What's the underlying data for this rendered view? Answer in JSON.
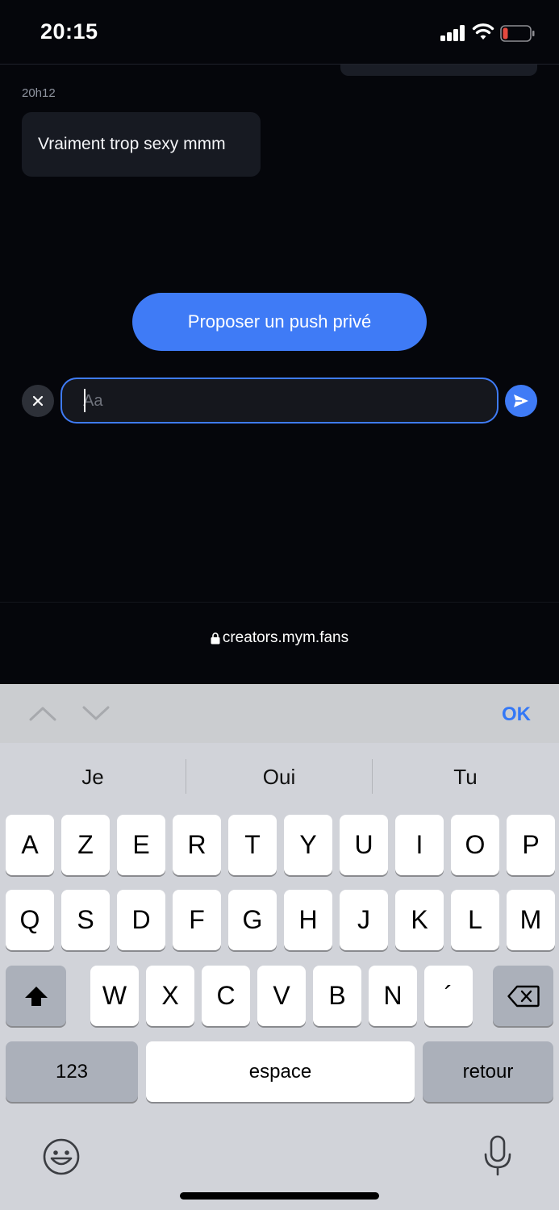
{
  "status_bar": {
    "time": "20:15",
    "icons": [
      "signal-icon",
      "wifi-icon",
      "battery-low-icon"
    ],
    "battery_color": "#e5493f"
  },
  "chat": {
    "message_time": "20h12",
    "message_text": "Vraiment trop sexy mmm",
    "push_button_label": "Proposer un push privé",
    "input_placeholder": "Aa",
    "input_value": ""
  },
  "url_bar": {
    "url": "creators.mym.fans"
  },
  "accessory": {
    "ok_label": "OK"
  },
  "keyboard": {
    "suggestions": [
      "Je",
      "Oui",
      "Tu"
    ],
    "row1": [
      "A",
      "Z",
      "E",
      "R",
      "T",
      "Y",
      "U",
      "I",
      "O",
      "P"
    ],
    "row2": [
      "Q",
      "S",
      "D",
      "F",
      "G",
      "H",
      "J",
      "K",
      "L",
      "M"
    ],
    "row3": [
      "W",
      "X",
      "C",
      "V",
      "B",
      "N",
      "´"
    ],
    "numbers_label": "123",
    "space_label": "espace",
    "return_label": "retour"
  },
  "colors": {
    "accent": "#3f7bf6",
    "background": "#05060b",
    "bubble": "#171a22",
    "ok_blue": "#3478f6"
  }
}
